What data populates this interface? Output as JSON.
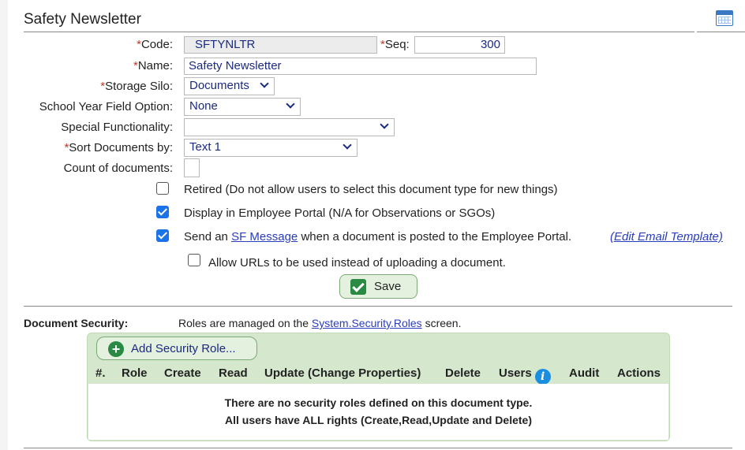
{
  "header": {
    "title": "Safety Newsletter",
    "icon": "calendar-grid-icon"
  },
  "form": {
    "required_mark": "*",
    "code_label": "Code:",
    "code_value": "SFTYNLTR",
    "seq_label": "Seq:",
    "seq_value": "300",
    "name_label": "Name:",
    "name_value": "Safety Newsletter",
    "storage_label": "Storage Silo:",
    "storage_value": "Documents",
    "school_year_label": "School Year Field Option:",
    "school_year_value": "None",
    "special_label": "Special Functionality:",
    "special_value": "",
    "sort_label": "Sort Documents by:",
    "sort_value": "Text 1",
    "count_label": "Count of documents:",
    "count_value": ""
  },
  "options": {
    "retired": {
      "label": "Retired (Do not allow users to select this document type for new things)",
      "checked": false
    },
    "portal": {
      "label": "Display in Employee Portal (N/A for Observations or SGOs)",
      "checked": true
    },
    "send": {
      "prefix": "Send an",
      "link": "SF Message",
      "suffix": "when a document is posted to the Employee Portal.",
      "edit_link": "(Edit Email Template)",
      "checked": true
    },
    "urls": {
      "label": "Allow URLs to be used instead of uploading a document.",
      "checked": false
    }
  },
  "save_label": "Save",
  "security": {
    "label": "Document Security:",
    "note_prefix": "Roles are managed on the",
    "note_link": "System.Security.Roles",
    "note_suffix": "screen.",
    "add_label": "Add Security Role...",
    "columns": [
      "#.",
      "Role",
      "Create",
      "Read",
      "Update (Change Properties)",
      "Delete",
      "Users",
      "Audit",
      "Actions"
    ],
    "empty_line1": "There are no security roles defined on this document type.",
    "empty_line2": "All users have ALL rights (Create,Read,Update and Delete)"
  },
  "colors": {
    "accent": "#1a73e8",
    "link": "#2a3dbd",
    "required": "#c0392b",
    "green": "#2a8a43",
    "panel_green": "#d5e8cd"
  }
}
